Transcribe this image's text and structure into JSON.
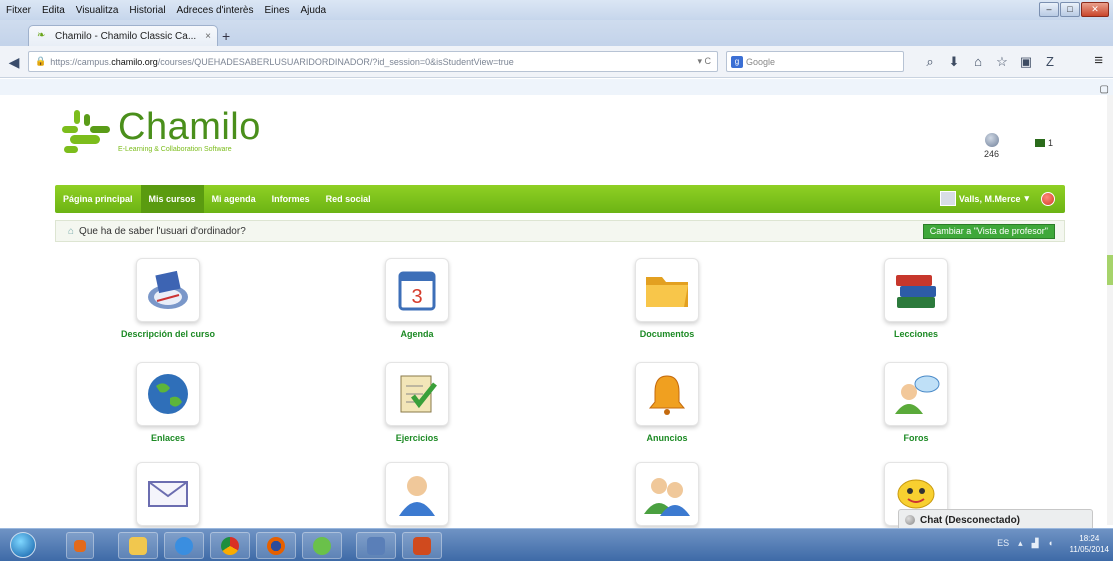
{
  "browser": {
    "menu": [
      "Fitxer",
      "Edita",
      "Visualitza",
      "Historial",
      "Adreces d'interès",
      "Eines",
      "Ajuda"
    ],
    "tab_title": "Chamilo - Chamilo Classic Ca...",
    "new_tab": "+",
    "url_scheme": "https://campus.",
    "url_host": "chamilo.org",
    "url_path": "/courses/QUEHADESABERLUSUARIDORDINADOR/?id_session=0&isStudentView=true",
    "search_placeholder": "Google",
    "window_controls": [
      "–",
      "□",
      "✕"
    ]
  },
  "header": {
    "logo_name": "Chamilo",
    "logo_tagline": "E-Learning & Collaboration Software",
    "count_1": "246",
    "count_2": "1"
  },
  "nav": {
    "items": [
      "Página principal",
      "Mis cursos",
      "Mi agenda",
      "Informes",
      "Red social"
    ],
    "active_index": 1,
    "user_name": "Valls, M.Merce"
  },
  "course": {
    "title": "Que ha de saber l'usuari d'ordinador?",
    "switch_button": "Cambiar a \"Vista de profesor\""
  },
  "tools": [
    {
      "label": "Descripción del curso",
      "icon": "course-description-icon"
    },
    {
      "label": "Agenda",
      "icon": "calendar-icon"
    },
    {
      "label": "Documentos",
      "icon": "folder-icon"
    },
    {
      "label": "Lecciones",
      "icon": "books-icon"
    },
    {
      "label": "Enlaces",
      "icon": "globe-icon"
    },
    {
      "label": "Ejercicios",
      "icon": "exercise-icon"
    },
    {
      "label": "Anuncios",
      "icon": "bell-icon"
    },
    {
      "label": "Foros",
      "icon": "forum-icon"
    },
    {
      "label": "",
      "icon": "envelope-icon"
    },
    {
      "label": "",
      "icon": "user-icon"
    },
    {
      "label": "",
      "icon": "group-icon"
    },
    {
      "label": "",
      "icon": "smiley-icon"
    }
  ],
  "chat": {
    "label": "Chat (Desconectado)"
  },
  "taskbar": {
    "tray_lang": "ES",
    "time": "18:24",
    "date": "11/05/2014"
  }
}
